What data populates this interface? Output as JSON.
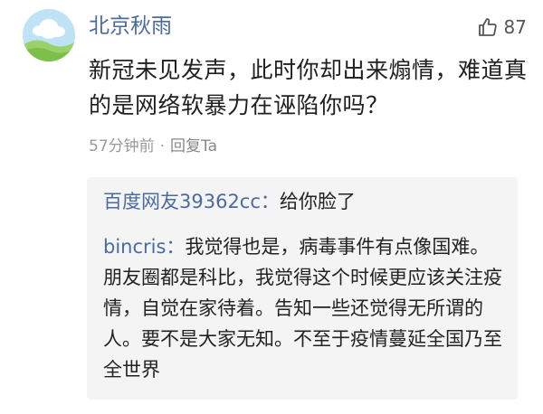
{
  "comment": {
    "username": "北京秋雨",
    "like_count": "87",
    "text": "新冠未见发声，此时你却出来煽情，难道真的是网络软暴力在诬陷你吗？",
    "time": "57分钟前",
    "separator": "·",
    "reply_label": "回复Ta"
  },
  "replies": [
    {
      "user": "百度网友39362cc：",
      "text": "给你脸了"
    },
    {
      "user": "bincris：",
      "text": "我觉得也是，病毒事件有点像国难。朋友圈都是科比，我觉得这个时候更应该关注疫情，自觉在家待着。告知一些还觉得无所谓的人。要不是大家无知。不至于疫情蔓延全国乃至全世界"
    }
  ],
  "colors": {
    "username": "#4a6aa0",
    "meta": "#9a9a9a",
    "reply_bg": "#f4f4f4"
  },
  "icons": {
    "like": "thumbs-up-icon",
    "avatar": "landscape-avatar"
  }
}
